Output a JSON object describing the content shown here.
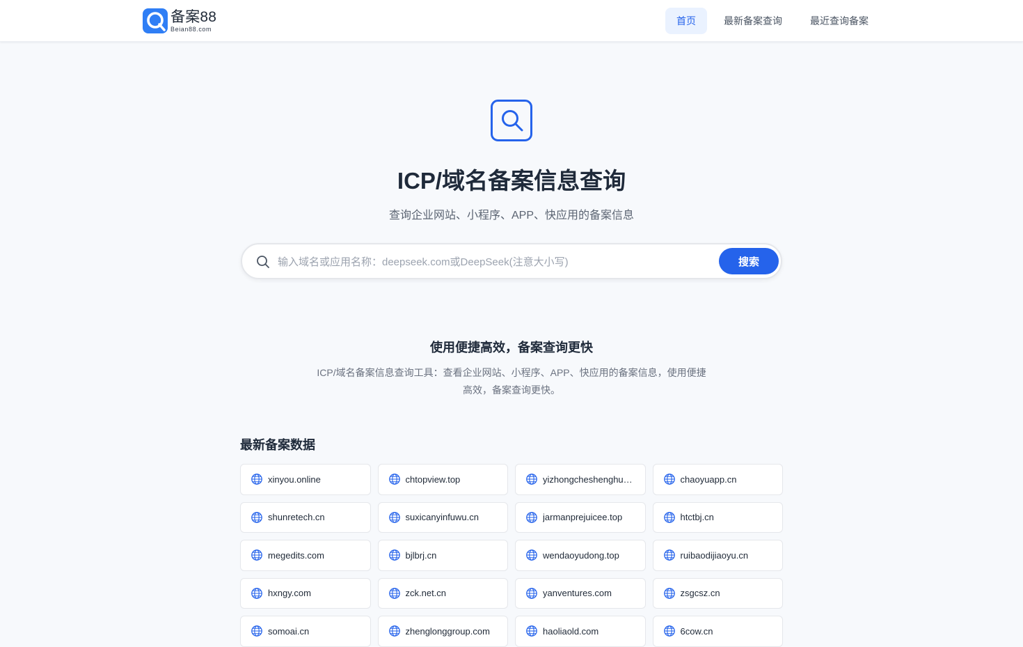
{
  "header": {
    "logo_title": "备案88",
    "logo_sub": "Beian88.com",
    "nav": [
      {
        "label": "首页",
        "active": true
      },
      {
        "label": "最新备案查询",
        "active": false
      },
      {
        "label": "最近查询备案",
        "active": false
      }
    ]
  },
  "hero": {
    "icon": "search-icon",
    "title": "ICP/域名备案信息查询",
    "subtitle": "查询企业网站、小程序、APP、快应用的备案信息"
  },
  "search": {
    "placeholder": "输入域名或应用名称：deepseek.com或DeepSeek(注意大小写)",
    "value": "",
    "button_label": "搜索"
  },
  "feature": {
    "title": "使用便捷高效，备案查询更快",
    "description": "ICP/域名备案信息查询工具：查看企业网站、小程序、APP、快应用的备案信息，使用便捷高效，备案查询更快。"
  },
  "latest": {
    "title": "最新备案数据",
    "domains": [
      "xinyou.online",
      "chtopview.top",
      "yizhongcheshenghu…",
      "chaoyuapp.cn",
      "shunretech.cn",
      "suxicanyinfuwu.cn",
      "jarmanprejuicee.top",
      "htctbj.cn",
      "megedits.com",
      "bjlbrj.cn",
      "wendaoyudong.top",
      "ruibaodijiaoyu.cn",
      "hxngy.com",
      "zck.net.cn",
      "yanventures.com",
      "zsgcsz.cn",
      "somoai.cn",
      "zhenglonggroup.com",
      "haoliaold.com",
      "6cow.cn"
    ]
  },
  "colors": {
    "accent": "#2563eb",
    "nav_active_bg": "#eaf2ff",
    "page_bg": "#f7f9fc"
  }
}
